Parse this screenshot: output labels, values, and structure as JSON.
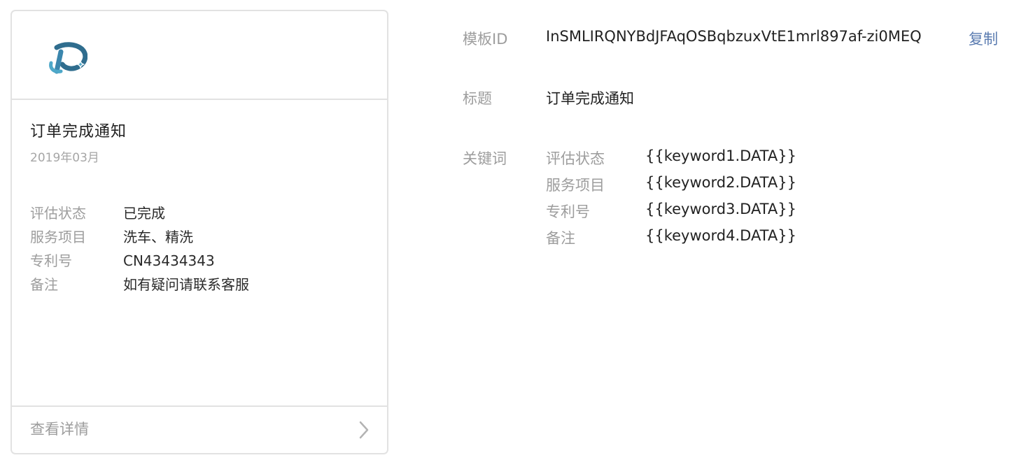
{
  "preview": {
    "title": "订单完成通知",
    "date": "2019年03月",
    "fields": [
      {
        "label": "评估状态",
        "value": "已完成"
      },
      {
        "label": "服务项目",
        "value": "洗车、精洗"
      },
      {
        "label": "专利号",
        "value": "CN43434343"
      },
      {
        "label": "备注",
        "value": "如有疑问请联系客服"
      }
    ],
    "footer_label": "查看详情",
    "logo_color": "#2f6d8e",
    "logo_accent": "#4ea8c9"
  },
  "detail": {
    "template_id_label": "模板ID",
    "template_id": "InSMLIRQNYBdJFAqOSBqbzuxVtE1mrl897af-zi0MEQ",
    "copy_label": "复制",
    "title_label": "标题",
    "title": "订单完成通知",
    "keywords_label": "关键词",
    "keywords": [
      {
        "name": "评估状态",
        "value": "{{keyword1.DATA}}"
      },
      {
        "name": "服务项目",
        "value": "{{keyword2.DATA}}"
      },
      {
        "name": "专利号",
        "value": "{{keyword3.DATA}}"
      },
      {
        "name": "备注",
        "value": "{{keyword4.DATA}}"
      }
    ],
    "link_color": "#5a7bb0"
  }
}
